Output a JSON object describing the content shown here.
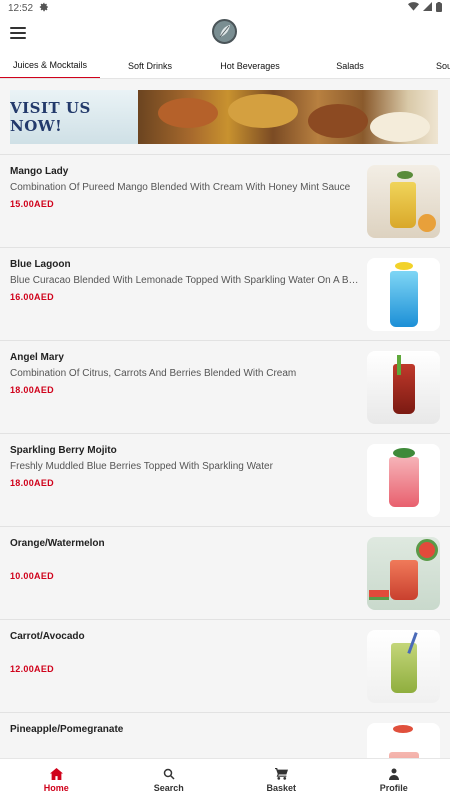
{
  "status": {
    "time": "12:52"
  },
  "tabs": [
    {
      "label": "Juices & Mocktails",
      "active": true
    },
    {
      "label": "Soft Drinks"
    },
    {
      "label": "Hot Beverages"
    },
    {
      "label": "Salads"
    },
    {
      "label": "Sou"
    }
  ],
  "banner": {
    "text": "VISIT US NOW!"
  },
  "currency": "AED",
  "items": [
    {
      "name": "Mango Lady",
      "description": "Combination Of Pureed Mango Blended With Cream With Honey Mint Sauce",
      "price": "15.00AED"
    },
    {
      "name": "Blue Lagoon",
      "description": "Blue Curacao Blended With Lemonade Topped With Sparkling Water On A Bed Of Ice",
      "price": "16.00AED"
    },
    {
      "name": "Angel Mary",
      "description": "Combination Of Citrus, Carrots And Berries Blended With Cream",
      "price": "18.00AED"
    },
    {
      "name": "Sparkling Berry Mojito",
      "description": "Freshly Muddled Blue Berries Topped With Sparkling Water",
      "price": "18.00AED"
    },
    {
      "name": "Orange/Watermelon",
      "description": "",
      "price": "10.00AED"
    },
    {
      "name": "Carrot/Avocado",
      "description": "",
      "price": "12.00AED"
    },
    {
      "name": "Pineapple/Pomegranate",
      "description": "",
      "price": ""
    }
  ],
  "bottom_nav": [
    {
      "label": "Home",
      "icon": "home-icon",
      "active": true
    },
    {
      "label": "Search",
      "icon": "search-icon"
    },
    {
      "label": "Basket",
      "icon": "cart-icon"
    },
    {
      "label": "Profile",
      "icon": "profile-icon"
    }
  ],
  "colors": {
    "accent": "#d0021b",
    "background": "#f5f5f5"
  }
}
